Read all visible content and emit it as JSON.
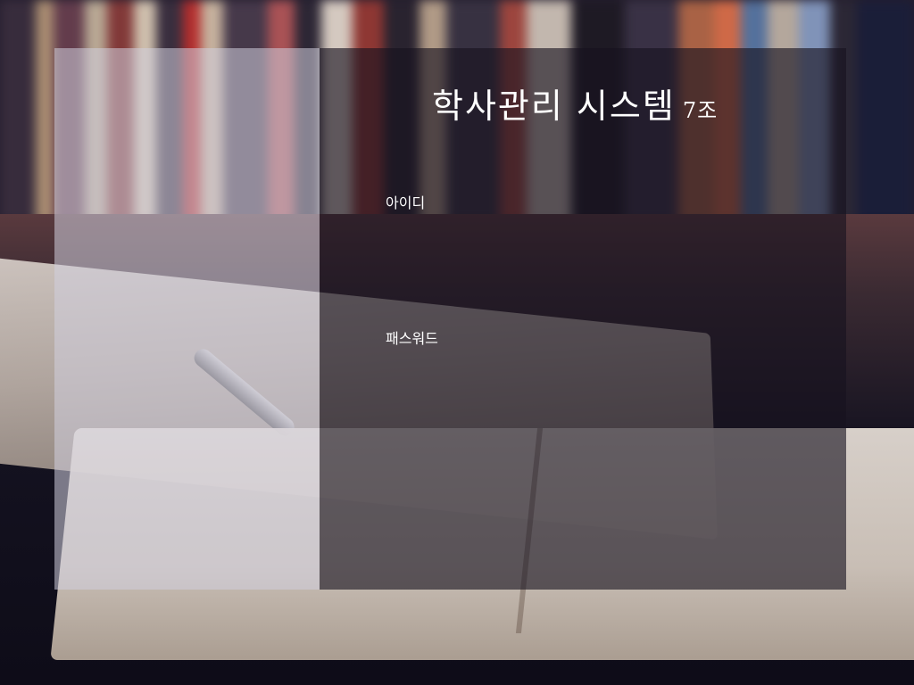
{
  "app": {
    "title": "학사관리 시스템",
    "team": "7조"
  },
  "login": {
    "id_label": "아이디",
    "id_value": "",
    "password_label": "패스워드",
    "password_value": ""
  },
  "colors": {
    "card_left_overlay": "#d2d0de",
    "card_right_overlay": "#16121e",
    "text": "#ffffff"
  }
}
